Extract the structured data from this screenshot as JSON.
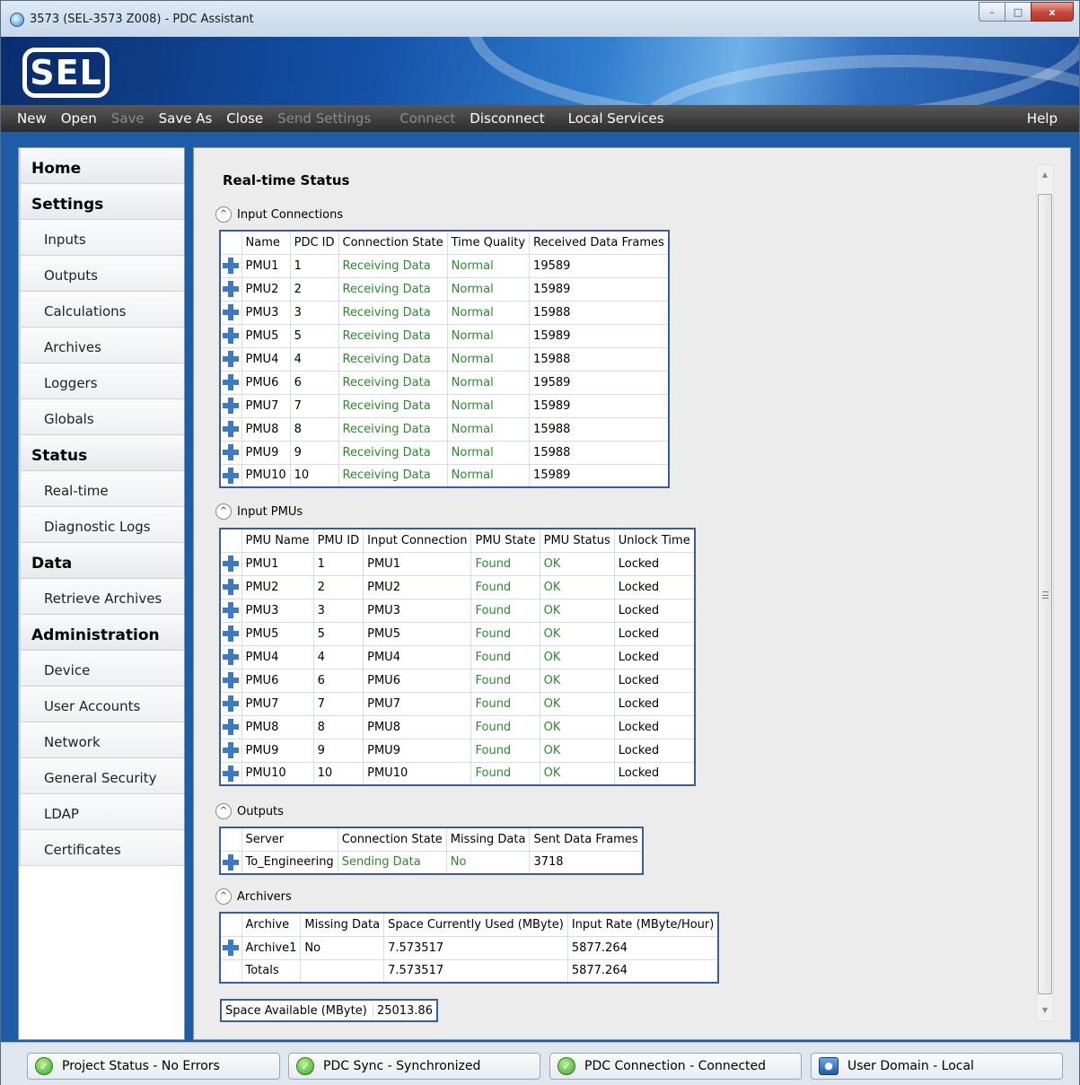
{
  "window": {
    "title": "3573 (SEL-3573 Z008) - PDC Assistant",
    "btn_min": "–",
    "btn_max": "□",
    "btn_close": "x"
  },
  "logo": "SEL",
  "menu": {
    "new": "New",
    "open": "Open",
    "save": "Save",
    "save_as": "Save As",
    "close": "Close",
    "send_settings": "Send Settings",
    "connect": "Connect",
    "disconnect": "Disconnect",
    "local_services": "Local Services",
    "help": "Help"
  },
  "nav": {
    "home": "Home",
    "settings": "Settings",
    "inputs": "Inputs",
    "outputs": "Outputs",
    "calculations": "Calculations",
    "archives": "Archives",
    "loggers": "Loggers",
    "globals": "Globals",
    "status": "Status",
    "realtime": "Real-time",
    "diaglogs": "Diagnostic Logs",
    "data": "Data",
    "retrieve": "Retrieve Archives",
    "administration": "Administration",
    "device": "Device",
    "users": "User Accounts",
    "network": "Network",
    "security": "General Security",
    "ldap": "LDAP",
    "certs": "Certificates"
  },
  "page_title": "Real-time Status",
  "input_connections": {
    "label": "Input Connections",
    "headers": [
      "Name",
      "PDC ID",
      "Connection State",
      "Time Quality",
      "Received Data Frames"
    ],
    "rows": [
      [
        "PMU1",
        "1",
        "Receiving Data",
        "Normal",
        "19589"
      ],
      [
        "PMU2",
        "2",
        "Receiving Data",
        "Normal",
        "15989"
      ],
      [
        "PMU3",
        "3",
        "Receiving Data",
        "Normal",
        "15988"
      ],
      [
        "PMU5",
        "5",
        "Receiving Data",
        "Normal",
        "15989"
      ],
      [
        "PMU4",
        "4",
        "Receiving Data",
        "Normal",
        "15988"
      ],
      [
        "PMU6",
        "6",
        "Receiving Data",
        "Normal",
        "19589"
      ],
      [
        "PMU7",
        "7",
        "Receiving Data",
        "Normal",
        "15989"
      ],
      [
        "PMU8",
        "8",
        "Receiving Data",
        "Normal",
        "15988"
      ],
      [
        "PMU9",
        "9",
        "Receiving Data",
        "Normal",
        "15988"
      ],
      [
        "PMU10",
        "10",
        "Receiving Data",
        "Normal",
        "15989"
      ]
    ]
  },
  "input_pmus": {
    "label": "Input PMUs",
    "headers": [
      "PMU Name",
      "PMU ID",
      "Input Connection",
      "PMU State",
      "PMU Status",
      "Unlock Time"
    ],
    "rows": [
      [
        "PMU1",
        "1",
        "PMU1",
        "Found",
        "OK",
        "Locked"
      ],
      [
        "PMU2",
        "2",
        "PMU2",
        "Found",
        "OK",
        "Locked"
      ],
      [
        "PMU3",
        "3",
        "PMU3",
        "Found",
        "OK",
        "Locked"
      ],
      [
        "PMU5",
        "5",
        "PMU5",
        "Found",
        "OK",
        "Locked"
      ],
      [
        "PMU4",
        "4",
        "PMU4",
        "Found",
        "OK",
        "Locked"
      ],
      [
        "PMU6",
        "6",
        "PMU6",
        "Found",
        "OK",
        "Locked"
      ],
      [
        "PMU7",
        "7",
        "PMU7",
        "Found",
        "OK",
        "Locked"
      ],
      [
        "PMU8",
        "8",
        "PMU8",
        "Found",
        "OK",
        "Locked"
      ],
      [
        "PMU9",
        "9",
        "PMU9",
        "Found",
        "OK",
        "Locked"
      ],
      [
        "PMU10",
        "10",
        "PMU10",
        "Found",
        "OK",
        "Locked"
      ]
    ]
  },
  "outputs": {
    "label": "Outputs",
    "headers": [
      "Server",
      "Connection State",
      "Missing Data",
      "Sent Data Frames"
    ],
    "rows": [
      [
        "To_Engineering",
        "Sending Data",
        "No",
        "3718"
      ]
    ]
  },
  "archivers": {
    "label": "Archivers",
    "headers": [
      "Archive",
      "Missing Data",
      "Space Currently Used (MByte)",
      "Input Rate (MByte/Hour)"
    ],
    "rows": [
      [
        "Archive1",
        "No",
        "7.573517",
        "5877.264"
      ]
    ],
    "totals": [
      "Totals",
      "",
      "7.573517",
      "5877.264"
    ]
  },
  "space_available": {
    "label": "Space Available (MByte)",
    "value": "25013.86"
  },
  "statusbar": {
    "project": "Project Status  - No Errors",
    "sync": "PDC Sync  - Synchronized",
    "connection": "PDC Connection  - Connected",
    "domain": "User Domain  - Local"
  },
  "colors": {
    "ok_green": "#2c8a2c",
    "grid_border": "#3a5c9c",
    "nav_blue": "#1f5ca6"
  }
}
